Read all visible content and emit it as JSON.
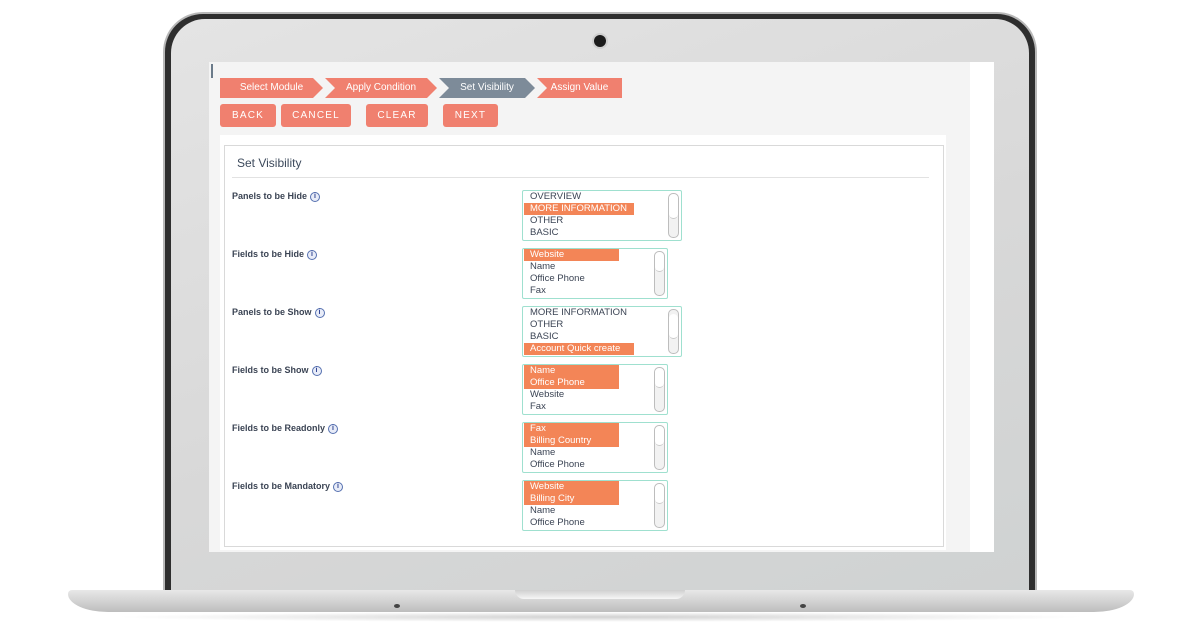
{
  "colors": {
    "step_active": "#7d8b99",
    "step_inactive": "#f0806f",
    "button": "#f0806f",
    "selected_option": "#f38557",
    "listbox_border": "#9fe0cf"
  },
  "wizard": {
    "steps": [
      {
        "label": "Select Module",
        "active": false
      },
      {
        "label": "Apply Condition",
        "active": false
      },
      {
        "label": "Set Visibility",
        "active": true
      },
      {
        "label": "Assign Value",
        "active": false
      }
    ]
  },
  "toolbar": {
    "back_label": "BACK",
    "cancel_label": "CANCEL",
    "clear_label": "CLEAR",
    "next_label": "NEXT"
  },
  "panel": {
    "title": "Set Visibility",
    "info_glyph": "i",
    "fields": [
      {
        "label": "Panels to be Hide",
        "options": [
          {
            "text": "OVERVIEW",
            "selected": false
          },
          {
            "text": "MORE INFORMATION",
            "selected": true
          },
          {
            "text": "OTHER",
            "selected": false
          },
          {
            "text": "BASIC",
            "selected": false
          }
        ]
      },
      {
        "label": "Fields to be Hide",
        "options": [
          {
            "text": "Website",
            "selected": true
          },
          {
            "text": "Name",
            "selected": false
          },
          {
            "text": "Office Phone",
            "selected": false
          },
          {
            "text": "Fax",
            "selected": false
          }
        ]
      },
      {
        "label": "Panels to be Show",
        "options": [
          {
            "text": "MORE INFORMATION",
            "selected": false
          },
          {
            "text": "OTHER",
            "selected": false
          },
          {
            "text": "BASIC",
            "selected": false
          },
          {
            "text": "Account Quick create",
            "selected": true
          }
        ]
      },
      {
        "label": "Fields to be Show",
        "options": [
          {
            "text": "Name",
            "selected": true
          },
          {
            "text": "Office Phone",
            "selected": true
          },
          {
            "text": "Website",
            "selected": false
          },
          {
            "text": "Fax",
            "selected": false
          }
        ]
      },
      {
        "label": "Fields to be Readonly",
        "options": [
          {
            "text": "Fax",
            "selected": true
          },
          {
            "text": "Billing Country",
            "selected": true
          },
          {
            "text": "Name",
            "selected": false
          },
          {
            "text": "Office Phone",
            "selected": false
          }
        ]
      },
      {
        "label": "Fields to be Mandatory",
        "options": [
          {
            "text": "Website",
            "selected": true
          },
          {
            "text": "Billing City",
            "selected": true
          },
          {
            "text": "Name",
            "selected": false
          },
          {
            "text": "Office Phone",
            "selected": false
          }
        ]
      }
    ]
  }
}
